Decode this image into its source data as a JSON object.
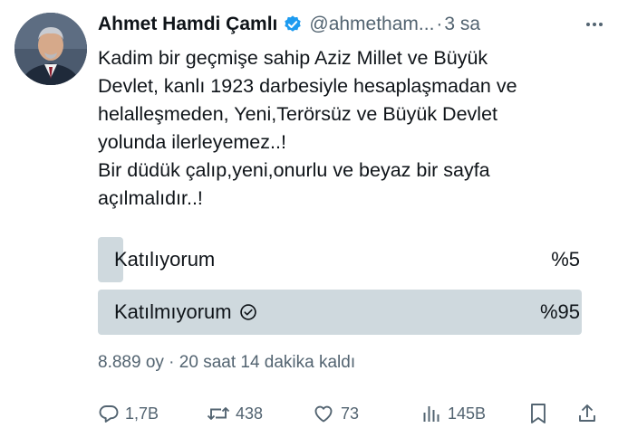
{
  "tweet": {
    "author_name": "Ahmet Hamdi Çamlı",
    "handle": "@ahmetham...",
    "time_separator": "·",
    "time": "3 sa",
    "text_lines": [
      "Kadim bir geçmişe sahip Aziz Millet  ve Büyük",
      "Devlet, kanlı 1923 darbesiyle hesaplaşmadan ve",
      "helalleşmeden, Yeni,Terörsüz ve Büyük Devlet",
      "yolunda ilerleyemez..!",
      "Bir düdük çalıp,yeni,onurlu ve beyaz bir sayfa",
      "açılmalıdır..!"
    ]
  },
  "poll": {
    "options": [
      {
        "label": "Katılıyorum",
        "percent_label": "%5",
        "percent": 5,
        "selected": false
      },
      {
        "label": "Katılmıyorum",
        "percent_label": "%95",
        "percent": 95,
        "selected": true
      }
    ],
    "meta": "8.889 oy · 20 saat 14 dakika kaldı"
  },
  "actions": {
    "replies": "1,7B",
    "retweets": "438",
    "likes": "73",
    "views": "145B"
  },
  "colors": {
    "text": "#0f1419",
    "secondary": "#536471",
    "verified": "#1d9bf0",
    "poll_bar": "#cfd9de"
  },
  "icons": [
    "verified-badge-icon",
    "more-icon",
    "check-circle-icon",
    "reply-icon",
    "retweet-icon",
    "like-icon",
    "views-icon",
    "bookmark-icon",
    "share-icon"
  ]
}
